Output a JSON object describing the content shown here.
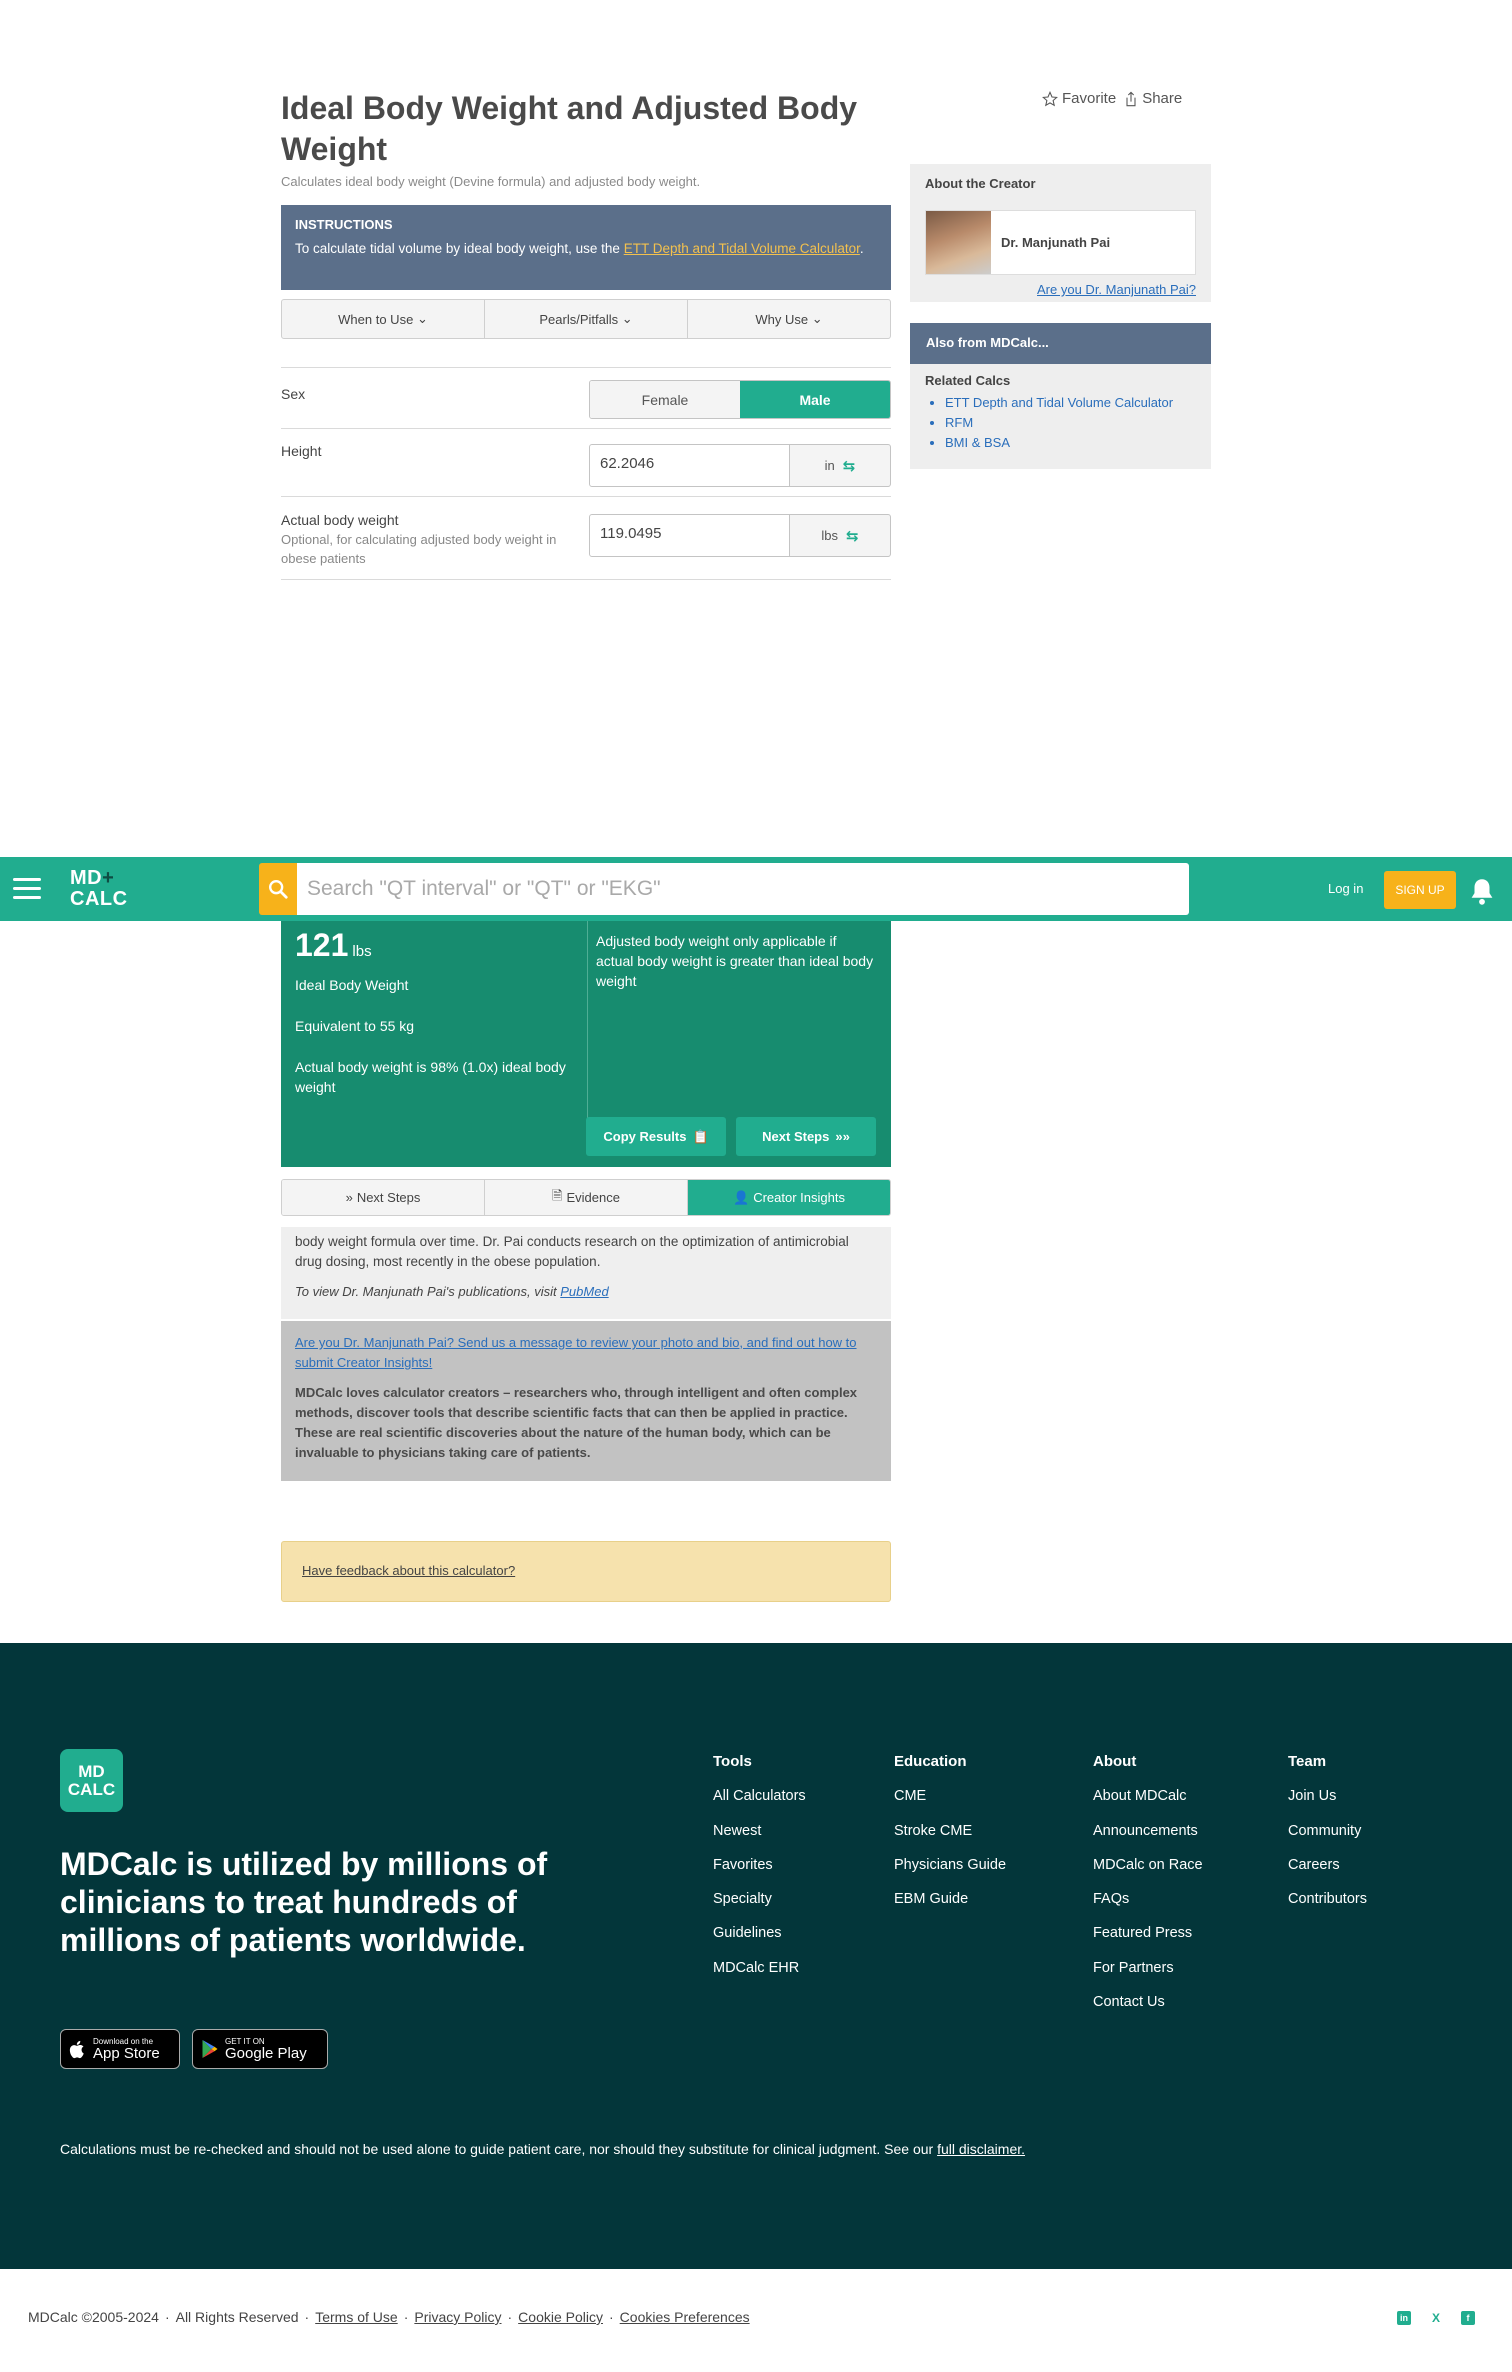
{
  "page": {
    "title": "Ideal Body Weight and Adjusted Body Weight",
    "subtitle": "Calculates ideal body weight (Devine formula) and adjusted body weight.",
    "favorite_label": "Favorite",
    "share_label": "Share"
  },
  "instructions": {
    "heading": "INSTRUCTIONS",
    "text_before": "To calculate tidal volume by ideal body weight, use the ",
    "link": "ETT Depth and Tidal Volume Calculator",
    "text_after": "."
  },
  "info_tabs": [
    "When to Use",
    "Pearls/Pitfalls",
    "Why Use"
  ],
  "form": {
    "sex": {
      "label": "Sex",
      "options": [
        "Female",
        "Male"
      ],
      "selected": "Male"
    },
    "height": {
      "label": "Height",
      "value": "62.2046",
      "unit": "in"
    },
    "weight": {
      "label": "Actual body weight",
      "help": "Optional, for calculating adjusted body weight in obese patients",
      "value": "119.0495",
      "unit": "lbs"
    }
  },
  "sidebar": {
    "about_heading": "About the Creator",
    "creator_name": "Dr. Manjunath Pai",
    "creator_question": "Are you Dr. Manjunath Pai?",
    "also_heading": "Also from MDCalc...",
    "related_heading": "Related Calcs",
    "related": [
      "ETT Depth and Tidal Volume Calculator",
      "RFM",
      "BMI & BSA"
    ]
  },
  "nav": {
    "logo_top": "MD",
    "logo_plus": "+",
    "logo_bottom": "CALC",
    "search_placeholder": "Search \"QT interval\" or \"QT\" or \"EKG\"",
    "login": "Log in",
    "signup": "SIGN UP"
  },
  "results": {
    "ibw_value": "121",
    "ibw_unit": "lbs",
    "ibw_label": "Ideal Body Weight",
    "equivalent": "Equivalent to 55 kg",
    "ratio": "Actual body weight is 98% (1.0x) ideal body weight",
    "abw_note": "Adjusted body weight only applicable if actual body weight is greater than ideal body weight",
    "copy_label": "Copy Results",
    "next_label": "Next Steps"
  },
  "bottom_tabs": [
    "Next Steps",
    "Evidence",
    "Creator Insights"
  ],
  "insights": {
    "text": "body weight formula over time. Dr. Pai conducts research on the optimization of antimicrobial drug dosing, most recently in the obese population.",
    "pubs_before": "To view Dr. Manjunath Pai's publications, visit ",
    "pubs_link": "PubMed",
    "cta": "Are you Dr. Manjunath Pai? Send us a message to review your photo and bio, and find out how to submit Creator Insights!",
    "love": "MDCalc loves calculator creators – researchers who, through intelligent and often complex methods, discover tools that describe scientific facts that can then be applied in practice. These are real scientific discoveries about the nature of the human body, which can be invaluable to physicians taking care of patients."
  },
  "feedback": "Have feedback about this calculator?",
  "footer": {
    "logo_top": "MD",
    "logo_bottom": "CALC",
    "tagline": "MDCalc is utilized by millions of clinicians to treat hundreds of millions of patients worldwide.",
    "app_store_small": "Download on the",
    "app_store": "App Store",
    "google_small": "GET IT ON",
    "google": "Google Play",
    "columns": [
      {
        "heading": "Tools",
        "items": [
          "All Calculators",
          "Newest",
          "Favorites",
          "Specialty",
          "Guidelines",
          "MDCalc EHR"
        ]
      },
      {
        "heading": "Education",
        "items": [
          "CME",
          "Stroke CME",
          "Physicians Guide",
          "EBM Guide"
        ]
      },
      {
        "heading": "About",
        "items": [
          "About MDCalc",
          "Announcements",
          "MDCalc on Race",
          "FAQs",
          "Featured Press",
          "For Partners",
          "Contact Us"
        ]
      },
      {
        "heading": "Team",
        "items": [
          "Join Us",
          "Community",
          "Careers",
          "Contributors"
        ]
      }
    ],
    "disclaimer": "Calculations must be re-checked and should not be used alone to guide patient care, nor should they substitute for clinical judgment. See our ",
    "disclaimer_link": "full disclaimer."
  },
  "bottom": {
    "copyright": "MDCalc ©2005-2024",
    "rights": "All Rights Reserved",
    "links": [
      "Terms of Use",
      "Privacy Policy",
      "Cookie Policy",
      "Cookies Preferences"
    ],
    "social": [
      "in",
      "X",
      "f"
    ]
  },
  "colors": {
    "brand": "#21ad8f",
    "brand_dark": "#178c6f",
    "footer_bg": "#03363a",
    "accent": "#f7b21a",
    "slate": "#5b6f8a"
  }
}
